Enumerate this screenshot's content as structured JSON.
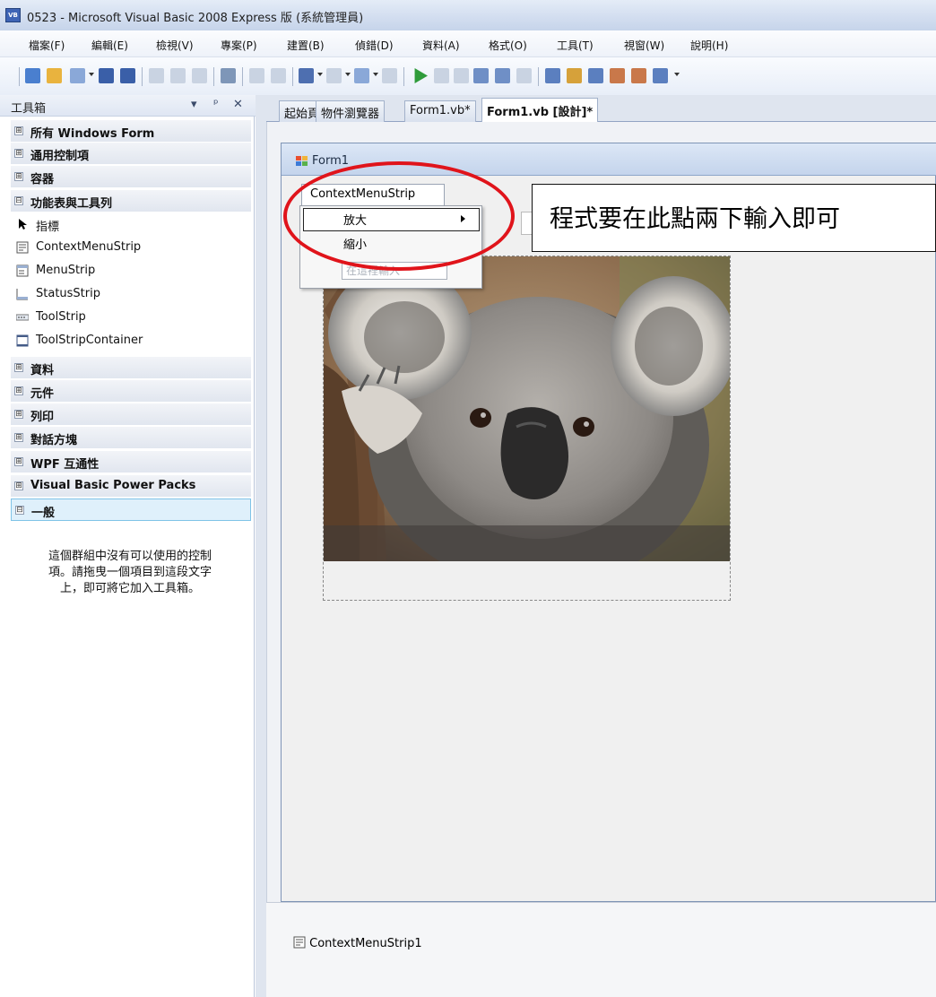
{
  "window": {
    "title": "0523 - Microsoft Visual Basic 2008 Express 版 (系統管理員)",
    "app_icon": "VB"
  },
  "menubar": {
    "items": [
      "檔案(F)",
      "編輯(E)",
      "檢視(V)",
      "專案(P)",
      "建置(B)",
      "偵錯(D)",
      "資料(A)",
      "格式(O)",
      "工具(T)",
      "視窗(W)",
      "說明(H)"
    ]
  },
  "toolbox": {
    "title": "工具箱",
    "pin": "ᵖ",
    "close": "✕",
    "groups_top": [
      "所有 Windows Form",
      "通用控制項",
      "容器",
      "功能表與工具列"
    ],
    "items": [
      "指標",
      "ContextMenuStrip",
      "MenuStrip",
      "StatusStrip",
      "ToolStrip",
      "ToolStripContainer"
    ],
    "groups_bottom": [
      "資料",
      "元件",
      "列印",
      "對話方塊",
      "WPF 互通性",
      "Visual Basic Power Packs",
      "一般"
    ],
    "plus": "⊞",
    "minus": "⊟",
    "empty_message": "這個群組中沒有可以使用的控制\n項。請拖曳一個項目到這段文字\n上，即可將它加入工具箱。"
  },
  "tabs": [
    "起始頁",
    "物件瀏覽器",
    "Form1.vb*",
    "Form1.vb [設計]*"
  ],
  "form": {
    "title": "Form1",
    "context_menu_strip": "ContextMenuStrip",
    "menu_items": [
      "放大",
      "縮小"
    ],
    "type_here": "在這裡輸入"
  },
  "callout": {
    "text": "程式要在此點兩下輸入即可"
  },
  "component_tray": {
    "item": "ContextMenuStrip1"
  },
  "colors": {
    "accent": "#3e64b5",
    "highlight_oval": "#e0141b",
    "selected_group": "#dff0fb"
  }
}
